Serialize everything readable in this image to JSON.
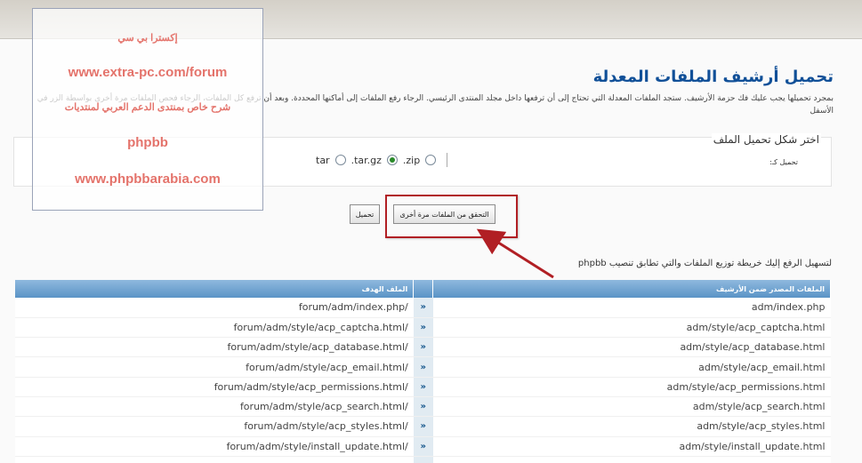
{
  "page": {
    "title": "تحميل أرشيف الملفات المعدلة",
    "intro": "بمجرد تحميلها يجب عليك فك حزمة الأرشيف. ستجد الملفات المعدلة التي تحتاج إلى أن ترفعها داخل مجلد المنتدى الرئيسي. الرجاء رفع الملفات إلى أماكنها المحددة. وبعد أن ترفع كل الملفات، الرجاء فحص الملفات مرة أخرى بواسطة الزر في الأسفل"
  },
  "format": {
    "legend": "اختر شكل تحميل الملف",
    "label": "تحميل كـ:",
    "options": [
      ".zip",
      ".tar.gz",
      "tar"
    ],
    "selected": ".zip"
  },
  "buttons": {
    "download": "تحميل",
    "check_again": "التحقق من الملفات مرة أخرى"
  },
  "table": {
    "caption": "لتسهيل الرفع إليك خريطة توزيع الملفات والتي تطابق تنصيب phpbb",
    "header_source": "الملفات المصدر ضمن الأرشيف",
    "header_target": "الملف الهدف",
    "separator": "»",
    "rows": [
      {
        "source": "adm/index.php",
        "target": "forum/adm/index.php/"
      },
      {
        "source": "adm/style/acp_captcha.html",
        "target": "forum/adm/style/acp_captcha.html/"
      },
      {
        "source": "adm/style/acp_database.html",
        "target": "forum/adm/style/acp_database.html/"
      },
      {
        "source": "adm/style/acp_email.html",
        "target": "forum/adm/style/acp_email.html/"
      },
      {
        "source": "adm/style/acp_permissions.html",
        "target": "forum/adm/style/acp_permissions.html/"
      },
      {
        "source": "adm/style/acp_search.html",
        "target": "forum/adm/style/acp_search.html/"
      },
      {
        "source": "adm/style/acp_styles.html",
        "target": "forum/adm/style/acp_styles.html/"
      },
      {
        "source": "adm/style/install_update.html",
        "target": "forum/adm/style/install_update.html/"
      },
      {
        "source": "",
        "target": ""
      }
    ]
  },
  "watermark": {
    "lines": [
      "إكسترا بي سي",
      "www.extra-pc.com/forum",
      "شرح خاص بمنتدى الدعم العربي لمنتديات",
      "phpbb",
      "www.phpbbarabia.com"
    ]
  },
  "colors": {
    "title": "#115098",
    "table_header": "#5a93c6",
    "highlight": "#b11f24",
    "watermark_text": "#e4736b"
  }
}
